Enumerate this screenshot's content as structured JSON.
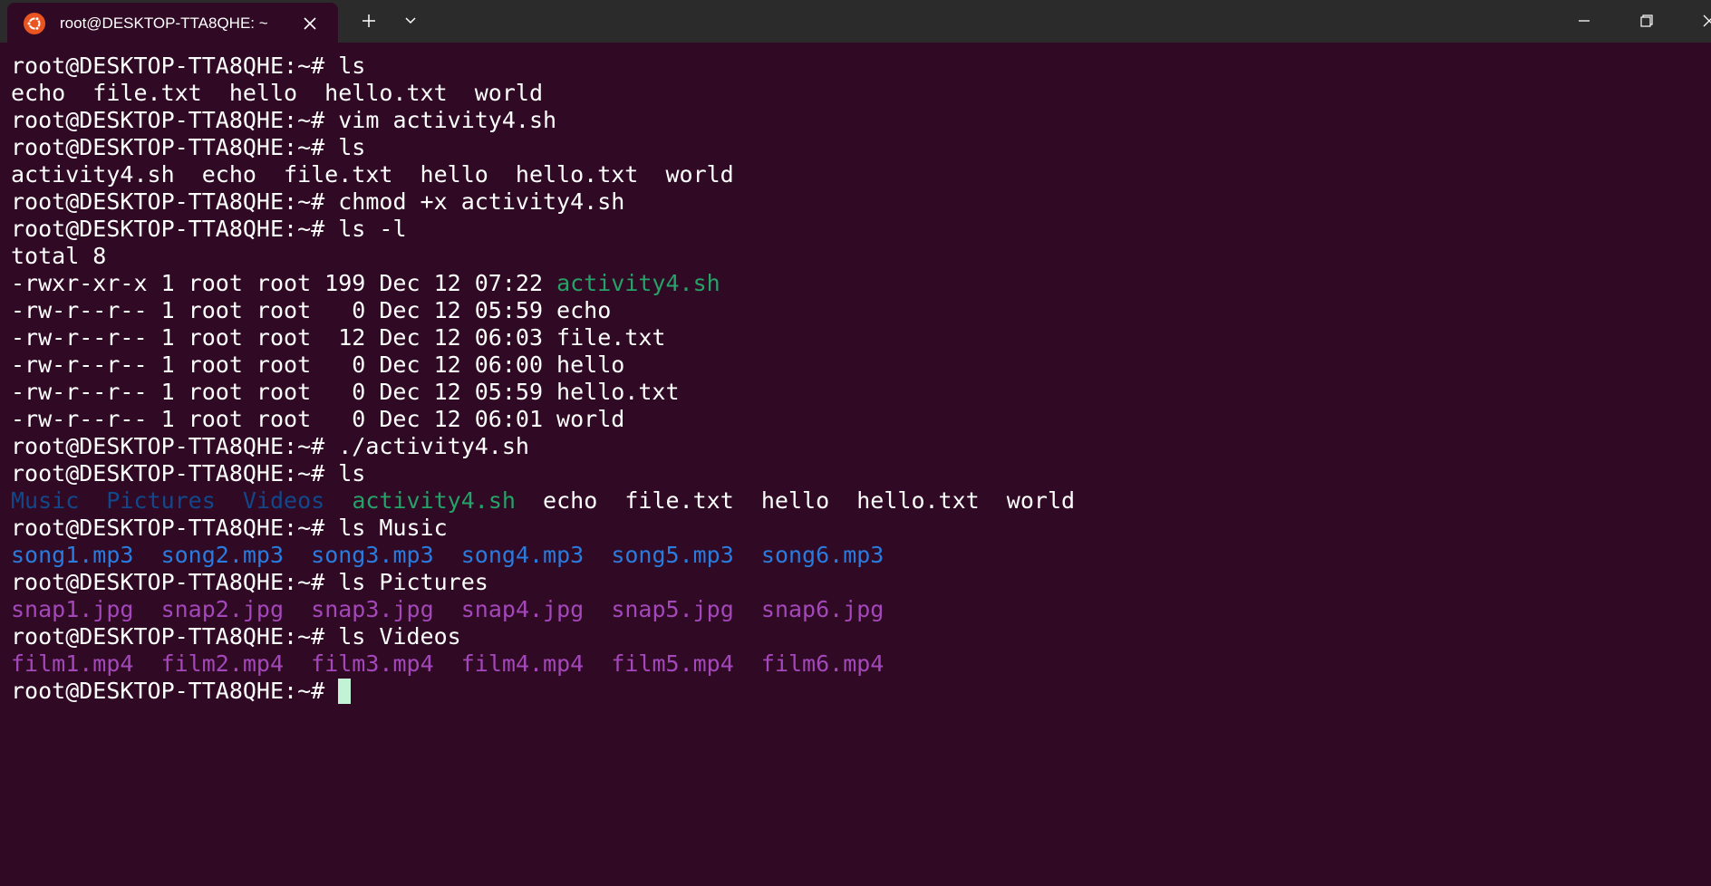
{
  "window": {
    "tab_title": "root@DESKTOP-TTA8QHE: ~",
    "icons": {
      "tab": "ubuntu-logo-icon",
      "tab_close": "close-icon",
      "new_tab": "plus-icon",
      "dropdown": "chevron-down-icon",
      "minimize": "minimize-icon",
      "maximize": "restore-icon",
      "close": "close-icon"
    }
  },
  "colors": {
    "background": "#300a24",
    "titlebar": "#2b2b2b",
    "text": "#ffffff",
    "executable": "#26a269",
    "directory": "#12488b",
    "audio": "#2a7bde",
    "image_video": "#a347ba",
    "cursor": "#c3f3d6",
    "ubuntu_orange": "#e95420"
  },
  "prompt": "root@DESKTOP-TTA8QHE:~# ",
  "terminal": {
    "lines": [
      {
        "cmd": "ls"
      },
      "echo  file.txt  hello  hello.txt  world",
      {
        "cmd": "vim activity4.sh"
      },
      {
        "cmd": "ls"
      },
      "activity4.sh  echo  file.txt  hello  hello.txt  world",
      {
        "cmd": "chmod +x activity4.sh"
      },
      {
        "cmd": "ls -l"
      },
      "total 8",
      [
        [
          "-rwxr-xr-x 1 root root 199 Dec 12 07:22 ",
          ""
        ],
        [
          "activity4.sh",
          "exec"
        ]
      ],
      "-rw-r--r-- 1 root root   0 Dec 12 05:59 echo",
      "-rw-r--r-- 1 root root  12 Dec 12 06:03 file.txt",
      "-rw-r--r-- 1 root root   0 Dec 12 06:00 hello",
      "-rw-r--r-- 1 root root   0 Dec 12 05:59 hello.txt",
      "-rw-r--r-- 1 root root   0 Dec 12 06:01 world",
      {
        "cmd": "./activity4.sh"
      },
      {
        "cmd": "ls"
      },
      [
        [
          "Music",
          "dir"
        ],
        [
          "  ",
          ""
        ],
        [
          "Pictures",
          "dir"
        ],
        [
          "  ",
          ""
        ],
        [
          "Videos",
          "dir"
        ],
        [
          "  ",
          ""
        ],
        [
          "activity4.sh",
          "exec"
        ],
        [
          "  echo  file.txt  hello  hello.txt  world",
          ""
        ]
      ],
      {
        "cmd": "ls Music"
      },
      [
        [
          "song1.mp3",
          "audio"
        ],
        [
          "  ",
          ""
        ],
        [
          "song2.mp3",
          "audio"
        ],
        [
          "  ",
          ""
        ],
        [
          "song3.mp3",
          "audio"
        ],
        [
          "  ",
          ""
        ],
        [
          "song4.mp3",
          "audio"
        ],
        [
          "  ",
          ""
        ],
        [
          "song5.mp3",
          "audio"
        ],
        [
          "  ",
          ""
        ],
        [
          "song6.mp3",
          "audio"
        ]
      ],
      {
        "cmd": "ls Pictures"
      },
      [
        [
          "snap1.jpg",
          "image"
        ],
        [
          "  ",
          ""
        ],
        [
          "snap2.jpg",
          "image"
        ],
        [
          "  ",
          ""
        ],
        [
          "snap3.jpg",
          "image"
        ],
        [
          "  ",
          ""
        ],
        [
          "snap4.jpg",
          "image"
        ],
        [
          "  ",
          ""
        ],
        [
          "snap5.jpg",
          "image"
        ],
        [
          "  ",
          ""
        ],
        [
          "snap6.jpg",
          "image"
        ]
      ],
      {
        "cmd": "ls Videos"
      },
      [
        [
          "film1.mp4",
          "image"
        ],
        [
          "  ",
          ""
        ],
        [
          "film2.mp4",
          "image"
        ],
        [
          "  ",
          ""
        ],
        [
          "film3.mp4",
          "image"
        ],
        [
          "  ",
          ""
        ],
        [
          "film4.mp4",
          "image"
        ],
        [
          "  ",
          ""
        ],
        [
          "film5.mp4",
          "image"
        ],
        [
          "  ",
          ""
        ],
        [
          "film6.mp4",
          "image"
        ]
      ],
      {
        "cmd": "",
        "cursor": true
      }
    ]
  }
}
